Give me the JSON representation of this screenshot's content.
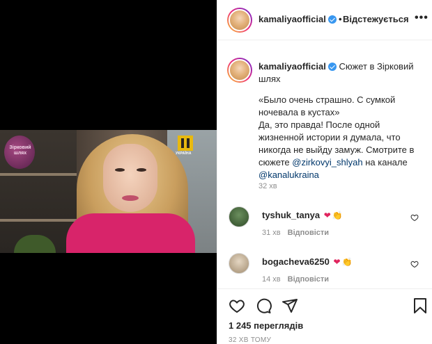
{
  "post": {
    "username": "kamaliya­official",
    "follow_label": "Відстежується",
    "dot": "•",
    "more_label": "•••"
  },
  "caption": {
    "username": "kamaliyaofficial",
    "title": "Сюжет в Зірковий шлях",
    "body_lines": [
      "«Было очень страшно. С сумкой ночевала в кустах»",
      "Да, это правда! После одной жизненной истории я думала, что никогда не выйду замуж. Смотрите в сюжете"
    ],
    "mention1": "@zirkovyi_shlyah",
    "connector": "на канале",
    "mention2": "@kanalukraina",
    "time": "32 хв"
  },
  "comments": [
    {
      "username": "tyshuk_tanya",
      "emojis": [
        "❤",
        "👏"
      ],
      "time": "31 хв",
      "reply": "Відповісти"
    },
    {
      "username": "bogacheva6250",
      "emojis": [
        "❤",
        "👏"
      ],
      "time": "14 хв",
      "reply": "Відповісти"
    }
  ],
  "stats": {
    "views": "1 245 переглядів",
    "ago": "32 ХВ ТОМУ"
  },
  "video": {
    "poster_text": "Зірковий шлях",
    "channel_logo": "УКРАЇНА"
  },
  "colors": {
    "verified": "#3897f0",
    "mention": "#00376b",
    "meta": "#8e8e8e",
    "heart": "#e0245e"
  }
}
